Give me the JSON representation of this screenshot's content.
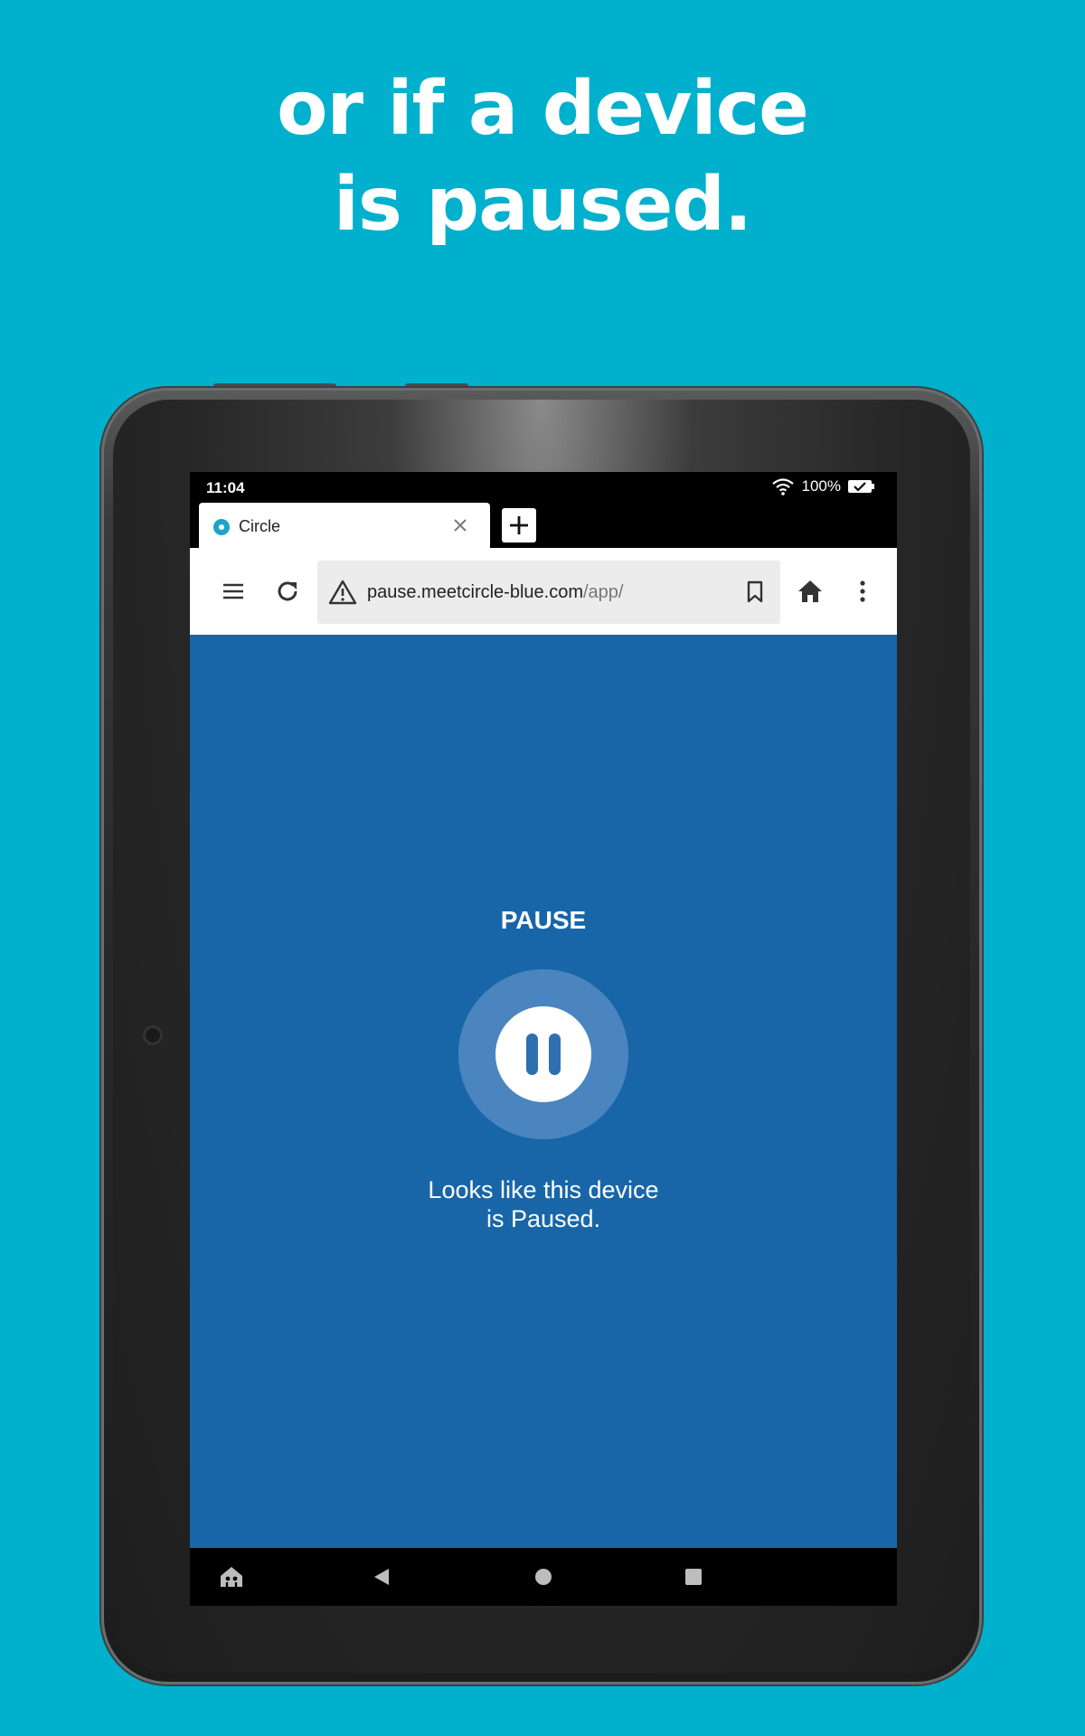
{
  "headline": {
    "line1": "or if a device",
    "line2": "is paused."
  },
  "status_bar": {
    "time": "11:04",
    "battery": "100%",
    "icons": [
      "wifi-icon",
      "battery-charged-icon"
    ]
  },
  "browser": {
    "tab": {
      "title": "Circle",
      "favicon": "circle-favicon-icon"
    },
    "toolbar": {
      "url_host": "pause.meetcircle-blue.com",
      "url_path": "/app/",
      "icons": [
        "menu-icon",
        "reload-icon",
        "warning-icon",
        "bookmark-icon",
        "home-icon",
        "more-icon"
      ]
    }
  },
  "page": {
    "title": "PAUSE",
    "message_line1": "Looks like this device",
    "message_line2": "is Paused.",
    "background": "#1866a8"
  },
  "nav_bar": {
    "icons": [
      "kids-home-icon",
      "back-icon",
      "home-circle-icon",
      "recents-icon"
    ]
  },
  "colors": {
    "backdrop": "#00b0cc",
    "page_blue": "#1866a8",
    "pause_ring": "#4a85c0"
  }
}
